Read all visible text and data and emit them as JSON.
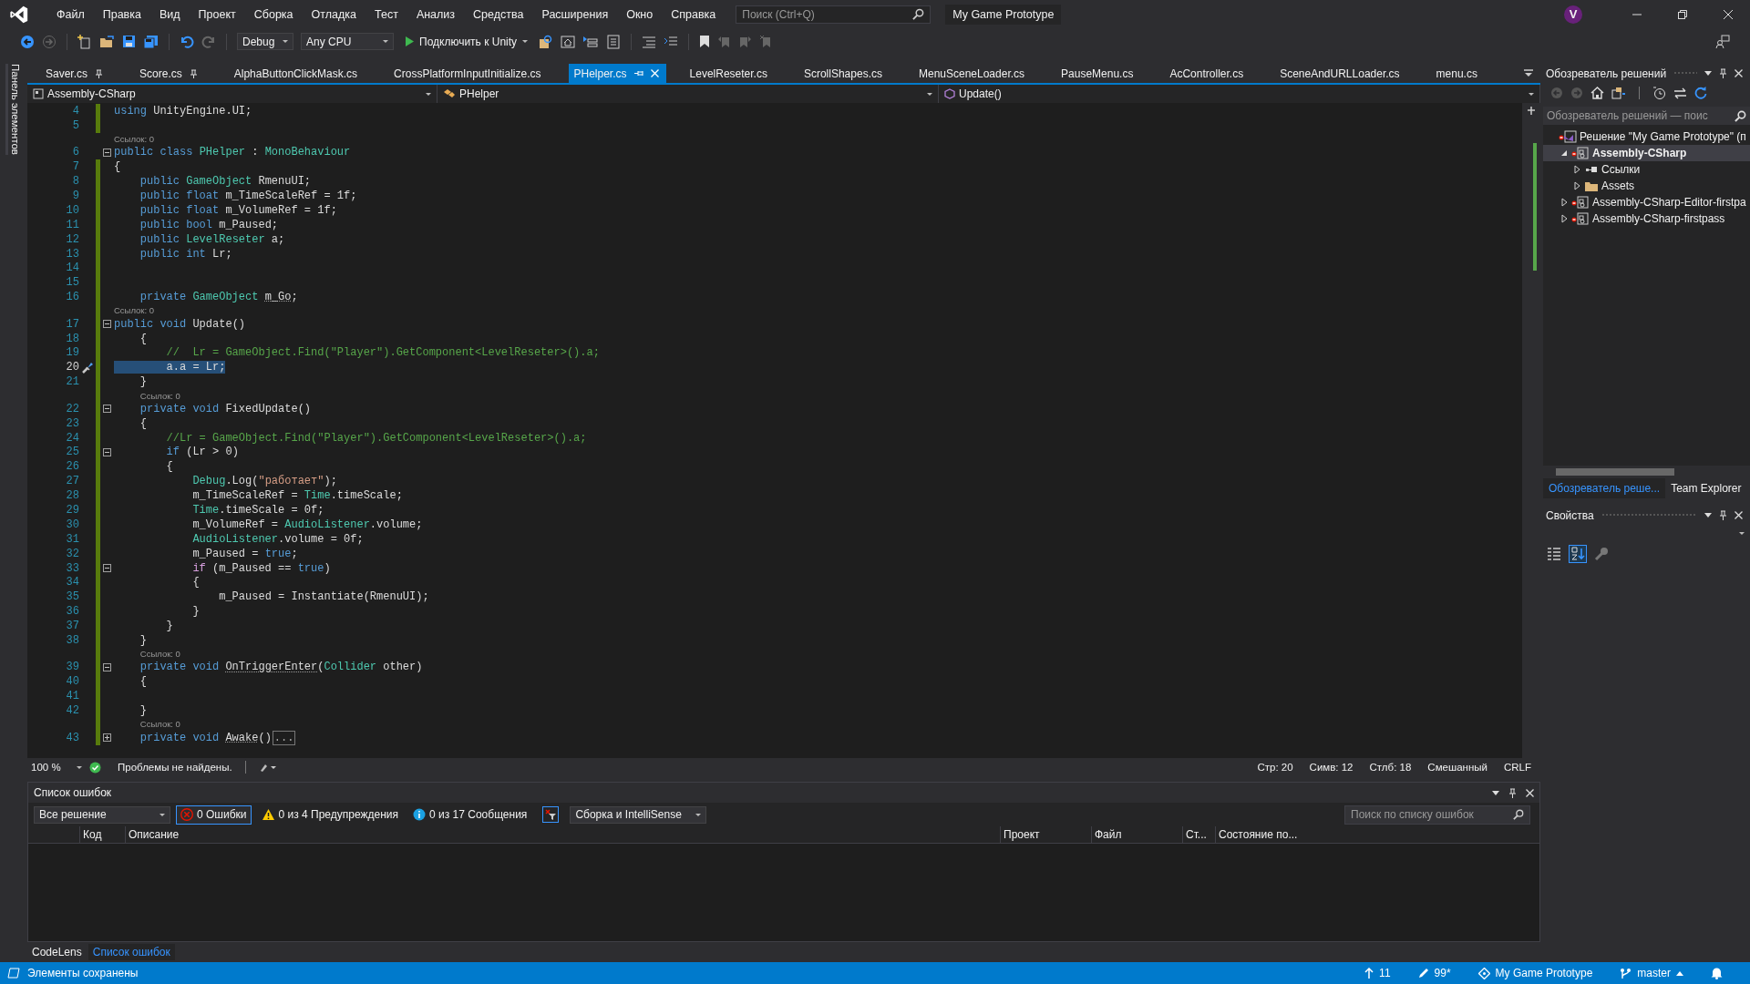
{
  "menu_bar": {
    "items": [
      "Файл",
      "Правка",
      "Вид",
      "Проект",
      "Сборка",
      "Отладка",
      "Тест",
      "Анализ",
      "Средства",
      "Расширения",
      "Окно",
      "Справка"
    ],
    "search": {
      "placeholder": "Поиск (Ctrl+Q)"
    },
    "solution_title": "My Game Prototype",
    "account_initial": "V"
  },
  "toolbar": {
    "configuration": "Debug",
    "platform": "Any CPU",
    "run_button": "Подключить к Unity"
  },
  "toolbox_strip": {
    "label": "Панель элементов"
  },
  "editor_tabs": [
    {
      "label": "Saver.cs",
      "pinned": true,
      "selected": false
    },
    {
      "label": "Score.cs",
      "pinned": true,
      "selected": false
    },
    {
      "label": "AlphaButtonClickMask.cs",
      "pinned": false,
      "selected": false
    },
    {
      "label": "CrossPlatformInputInitialize.cs",
      "pinned": false,
      "selected": false
    },
    {
      "label": "PHelper.cs",
      "pinned": false,
      "selected": true
    },
    {
      "label": "LevelReseter.cs",
      "pinned": false,
      "selected": false
    },
    {
      "label": "ScrollShapes.cs",
      "pinned": false,
      "selected": false
    },
    {
      "label": "MenuSceneLoader.cs",
      "pinned": false,
      "selected": false
    },
    {
      "label": "PauseMenu.cs",
      "pinned": false,
      "selected": false
    },
    {
      "label": "AcController.cs",
      "pinned": false,
      "selected": false
    },
    {
      "label": "SceneAndURLLoader.cs",
      "pinned": false,
      "selected": false
    },
    {
      "label": "menu.cs",
      "pinned": false,
      "selected": false
    }
  ],
  "navigation_bar": {
    "project": "Assembly-CSharp",
    "class": "PHelper",
    "member": "Update()"
  },
  "code": {
    "lines": [
      {
        "kind": "code",
        "number": "4",
        "changed": true,
        "selected": false,
        "tokens": [
          {
            "kind": "keyword",
            "text": "using"
          },
          {
            "kind": "plain",
            "text": " UnityEngine.UI;"
          }
        ]
      },
      {
        "kind": "code",
        "number": "5",
        "changed": true,
        "selected": false
      },
      {
        "kind": "codelens",
        "text": "Ссылок: 0"
      },
      {
        "kind": "code",
        "number": "6",
        "expanded": true,
        "changed": false,
        "selected": false,
        "tokens": [
          {
            "kind": "keyword",
            "text": "public class "
          },
          {
            "kind": "type",
            "text": "PHelper"
          },
          {
            "kind": "plain",
            "text": " : "
          },
          {
            "kind": "type",
            "text": "MonoBehaviour"
          }
        ]
      },
      {
        "kind": "code",
        "number": "7",
        "changed": true,
        "selected": false,
        "tokens": [
          {
            "kind": "plain",
            "text": "{"
          }
        ]
      },
      {
        "kind": "code",
        "number": "8",
        "changed": true,
        "selected": false,
        "tokens": [
          {
            "kind": "keyword",
            "text": "    public "
          },
          {
            "kind": "type",
            "text": "GameObject"
          },
          {
            "kind": "plain",
            "text": " RmenuUI;"
          }
        ]
      },
      {
        "kind": "code",
        "number": "9",
        "changed": true,
        "selected": false,
        "tokens": [
          {
            "kind": "keyword",
            "text": "    public float"
          },
          {
            "kind": "plain",
            "text": " m_TimeScaleRef = 1f;"
          }
        ]
      },
      {
        "kind": "code",
        "number": "10",
        "changed": true,
        "selected": false,
        "tokens": [
          {
            "kind": "keyword",
            "text": "    public float"
          },
          {
            "kind": "plain",
            "text": " m_VolumeRef = 1f;"
          }
        ]
      },
      {
        "kind": "code",
        "number": "11",
        "changed": true,
        "selected": false,
        "tokens": [
          {
            "kind": "keyword",
            "text": "    public bool"
          },
          {
            "kind": "plain",
            "text": " m_Paused;"
          }
        ]
      },
      {
        "kind": "code",
        "number": "12",
        "changed": true,
        "selected": false,
        "tokens": [
          {
            "kind": "keyword",
            "text": "    public "
          },
          {
            "kind": "type",
            "text": "LevelReseter"
          },
          {
            "kind": "plain",
            "text": " a;"
          }
        ]
      },
      {
        "kind": "code",
        "number": "13",
        "changed": true,
        "selected": false,
        "tokens": [
          {
            "kind": "keyword",
            "text": "    public int"
          },
          {
            "kind": "plain",
            "text": " Lr;"
          }
        ]
      },
      {
        "kind": "code",
        "number": "14",
        "changed": true,
        "selected": false
      },
      {
        "kind": "code",
        "number": "15",
        "changed": true,
        "selected": false
      },
      {
        "kind": "code",
        "number": "16",
        "changed": true,
        "selected": false,
        "tokens": [
          {
            "kind": "keyword",
            "text": "    private "
          },
          {
            "kind": "type",
            "text": "GameObject "
          },
          {
            "kind": "hint",
            "text": "m_Go"
          },
          {
            "kind": "plain",
            "text": ";"
          }
        ]
      },
      {
        "kind": "codelens",
        "text": "Ссылок: 0"
      },
      {
        "kind": "code",
        "number": "17",
        "expanded": true,
        "changed": true,
        "selected": false,
        "tokens": [
          {
            "kind": "keyword",
            "text": "public void"
          },
          {
            "kind": "plain",
            "text": " Update()"
          }
        ]
      },
      {
        "kind": "code",
        "number": "18",
        "changed": true,
        "selected": false,
        "tokens": [
          {
            "kind": "plain",
            "text": "    {"
          }
        ]
      },
      {
        "kind": "code",
        "number": "19",
        "changed": true,
        "selected": false,
        "tokens": [
          {
            "kind": "comment",
            "text": "        //  Lr = GameObject.Find(\"Player\").GetComponent<LevelReseter>().a;"
          }
        ]
      },
      {
        "kind": "code",
        "number": "20",
        "changed": true,
        "selected": true,
        "tokens": [
          {
            "kind": "plain",
            "text": "        a.a = Lr;"
          }
        ]
      },
      {
        "kind": "code",
        "number": "21",
        "changed": true,
        "selected": false,
        "tokens": [
          {
            "kind": "plain",
            "text": "    }"
          }
        ]
      },
      {
        "kind": "codelens",
        "text": "Ссылок: 0"
      },
      {
        "kind": "code",
        "number": "22",
        "expanded": true,
        "changed": true,
        "selected": false,
        "tokens": [
          {
            "kind": "keyword",
            "text": "    private void"
          },
          {
            "kind": "plain",
            "text": " FixedUpdate()"
          }
        ]
      },
      {
        "kind": "code",
        "number": "23",
        "changed": true,
        "selected": false,
        "tokens": [
          {
            "kind": "plain",
            "text": "    {"
          }
        ]
      },
      {
        "kind": "code",
        "number": "24",
        "changed": true,
        "selected": false,
        "tokens": [
          {
            "kind": "comment",
            "text": "        //Lr = GameObject.Find(\"Player\").GetComponent<LevelReseter>().a;"
          }
        ]
      },
      {
        "kind": "code",
        "number": "25",
        "expanded": true,
        "changed": true,
        "selected": false,
        "tokens": [
          {
            "kind": "keyword",
            "text": "        if"
          },
          {
            "kind": "plain",
            "text": " (Lr > 0)"
          }
        ]
      },
      {
        "kind": "code",
        "number": "26",
        "changed": true,
        "selected": false,
        "tokens": [
          {
            "kind": "plain",
            "text": "        {"
          }
        ]
      },
      {
        "kind": "code",
        "number": "27",
        "changed": true,
        "selected": false,
        "tokens": [
          {
            "kind": "type",
            "text": "            Debug"
          },
          {
            "kind": "plain",
            "text": ".Log("
          },
          {
            "kind": "string",
            "text": "\"работает\""
          },
          {
            "kind": "plain",
            "text": ");"
          }
        ]
      },
      {
        "kind": "code",
        "number": "28",
        "changed": true,
        "selected": false,
        "tokens": [
          {
            "kind": "plain",
            "text": "            m_TimeScaleRef = "
          },
          {
            "kind": "type",
            "text": "Time"
          },
          {
            "kind": "plain",
            "text": ".timeScale;"
          }
        ]
      },
      {
        "kind": "code",
        "number": "29",
        "changed": true,
        "selected": false,
        "tokens": [
          {
            "kind": "type",
            "text": "            Time"
          },
          {
            "kind": "plain",
            "text": ".timeScale = 0f;"
          }
        ]
      },
      {
        "kind": "code",
        "number": "30",
        "changed": true,
        "selected": false,
        "tokens": [
          {
            "kind": "plain",
            "text": "            m_VolumeRef = "
          },
          {
            "kind": "type",
            "text": "AudioListener"
          },
          {
            "kind": "plain",
            "text": ".volume;"
          }
        ]
      },
      {
        "kind": "code",
        "number": "31",
        "changed": true,
        "selected": false,
        "tokens": [
          {
            "kind": "type",
            "text": "            AudioListener"
          },
          {
            "kind": "plain",
            "text": ".volume = 0f;"
          }
        ]
      },
      {
        "kind": "code",
        "number": "32",
        "changed": true,
        "selected": false,
        "tokens": [
          {
            "kind": "plain",
            "text": "            m_Paused = "
          },
          {
            "kind": "keyword",
            "text": "true"
          },
          {
            "kind": "plain",
            "text": ";"
          }
        ]
      },
      {
        "kind": "code",
        "number": "33",
        "expanded": true,
        "changed": true,
        "selected": false,
        "tokens": [
          {
            "kind": "control",
            "text": "            if"
          },
          {
            "kind": "plain",
            "text": " (m_Paused == "
          },
          {
            "kind": "keyword",
            "text": "true"
          },
          {
            "kind": "plain",
            "text": ")"
          }
        ]
      },
      {
        "kind": "code",
        "number": "34",
        "changed": true,
        "selected": false,
        "tokens": [
          {
            "kind": "plain",
            "text": "            {"
          }
        ]
      },
      {
        "kind": "code",
        "number": "35",
        "changed": true,
        "selected": false,
        "tokens": [
          {
            "kind": "plain",
            "text": "                m_Paused = Instantiate(RmenuUI);"
          }
        ]
      },
      {
        "kind": "code",
        "number": "36",
        "changed": true,
        "selected": false,
        "tokens": [
          {
            "kind": "plain",
            "text": "            }"
          }
        ]
      },
      {
        "kind": "code",
        "number": "37",
        "changed": true,
        "selected": false,
        "tokens": [
          {
            "kind": "plain",
            "text": "        }"
          }
        ]
      },
      {
        "kind": "code",
        "number": "38",
        "changed": true,
        "selected": false,
        "tokens": [
          {
            "kind": "plain",
            "text": "    }"
          }
        ]
      },
      {
        "kind": "codelens",
        "text": "Ссылок: 0"
      },
      {
        "kind": "code",
        "number": "39",
        "expanded": true,
        "changed": true,
        "selected": false,
        "tokens": [
          {
            "kind": "keyword",
            "text": "    private void "
          },
          {
            "kind": "hint",
            "text": "OnTriggerEnter"
          },
          {
            "kind": "plain",
            "text": "("
          },
          {
            "kind": "type",
            "text": "Collider"
          },
          {
            "kind": "plain",
            "text": " other)"
          }
        ]
      },
      {
        "kind": "code",
        "number": "40",
        "changed": true,
        "selected": false,
        "tokens": [
          {
            "kind": "plain",
            "text": "    {"
          }
        ]
      },
      {
        "kind": "code",
        "number": "41",
        "changed": true,
        "selected": false
      },
      {
        "kind": "code",
        "number": "42",
        "changed": true,
        "selected": false,
        "tokens": [
          {
            "kind": "plain",
            "text": "    }"
          }
        ]
      },
      {
        "kind": "codelens",
        "text": "Ссылок: 0"
      },
      {
        "kind": "code",
        "number": "43",
        "expanded": false,
        "changed": true,
        "selected": false,
        "tokens": [
          {
            "kind": "keyword",
            "text": "    private void "
          },
          {
            "kind": "hint",
            "text": "Awake"
          },
          {
            "kind": "plain",
            "text": "()"
          },
          {
            "kind": "folded",
            "text": "..."
          }
        ]
      }
    ]
  },
  "editor_status": {
    "zoom": "100 %",
    "issues": "Проблемы не найдены.",
    "line": "Стр: 20",
    "char": "Симв: 12",
    "column": "Стлб: 18",
    "indentation": "Смешанный",
    "line_endings": "CRLF"
  },
  "error_list": {
    "title": "Список ошибок",
    "scope": "Все решение",
    "filters": [
      {
        "kind": "error",
        "label": "0 Ошибки",
        "selected": true
      },
      {
        "kind": "warning",
        "label": "0 из 4 Предупреждения",
        "selected": false
      },
      {
        "kind": "message",
        "label": "0 из 17 Сообщения",
        "selected": false
      }
    ],
    "source": "Сборка и IntelliSense",
    "search": {
      "placeholder": "Поиск по списку ошибок"
    },
    "columns": [
      "Код",
      "Описание",
      "Проект",
      "Файл",
      "Ст...",
      "Состояние по..."
    ]
  },
  "bottom_tabs": [
    {
      "label": "CodeLens",
      "selected": false
    },
    {
      "label": "Список ошибок",
      "selected": true
    }
  ],
  "solution_explorer": {
    "title": "Обозреватель решений",
    "search": {
      "placeholder": "Обозреватель решений — поис"
    },
    "tree": [
      {
        "label": "Решение \"My Game Prototype\" (п",
        "kind": "solution",
        "selected": false,
        "children": [
          {
            "label": "Assembly-CSharp",
            "kind": "project",
            "expanded": true,
            "selected": true,
            "children": [
              {
                "label": "Ссылки",
                "kind": "references",
                "expanded": false,
                "selected": false
              },
              {
                "label": "Assets",
                "kind": "folder",
                "expanded": false,
                "selected": false
              }
            ]
          },
          {
            "label": "Assembly-CSharp-Editor-firstpa",
            "kind": "project",
            "expanded": false,
            "selected": false
          },
          {
            "label": "Assembly-CSharp-firstpass",
            "kind": "project",
            "expanded": false,
            "selected": false
          }
        ]
      }
    ],
    "tabs": [
      {
        "label": "Обозреватель реше...",
        "selected": true
      },
      {
        "label": "Team Explorer",
        "selected": false
      }
    ]
  },
  "properties": {
    "title": "Свойства"
  },
  "status_bar": {
    "message": "Элементы сохранены",
    "commits": "11",
    "changes": "99*",
    "repository": "My Game Prototype",
    "branch": "master"
  }
}
